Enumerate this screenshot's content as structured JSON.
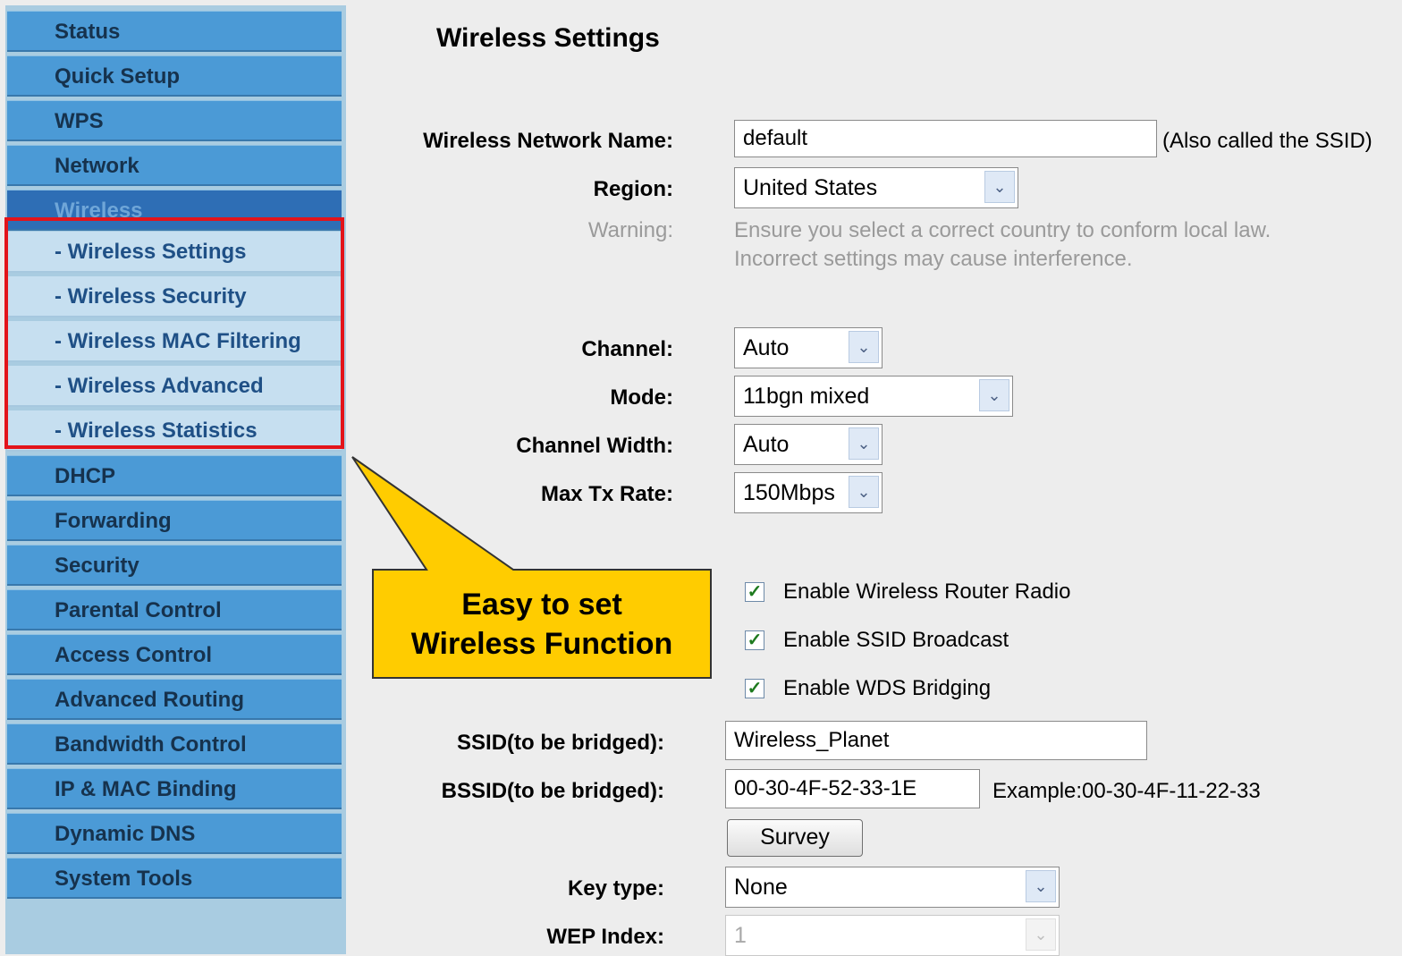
{
  "sidebar": {
    "items": [
      {
        "label": "Status"
      },
      {
        "label": "Quick Setup"
      },
      {
        "label": "WPS"
      },
      {
        "label": "Network"
      },
      {
        "label": "Wireless"
      },
      {
        "label": "DHCP"
      },
      {
        "label": "Forwarding"
      },
      {
        "label": "Security"
      },
      {
        "label": "Parental Control"
      },
      {
        "label": "Access Control"
      },
      {
        "label": "Advanced Routing"
      },
      {
        "label": "Bandwidth Control"
      },
      {
        "label": "IP & MAC Binding"
      },
      {
        "label": "Dynamic DNS"
      },
      {
        "label": "System Tools"
      }
    ],
    "active": "Wireless",
    "subitems": [
      {
        "label": "- Wireless Settings"
      },
      {
        "label": "- Wireless Security"
      },
      {
        "label": "- Wireless MAC Filtering"
      },
      {
        "label": "- Wireless Advanced"
      },
      {
        "label": "- Wireless Statistics"
      }
    ]
  },
  "callout": {
    "line1": "Easy to set",
    "line2": "Wireless Function"
  },
  "main": {
    "title": "Wireless Settings",
    "ssid": {
      "label": "Wireless Network Name:",
      "value": "default",
      "note": "(Also called the SSID)"
    },
    "region": {
      "label": "Region:",
      "value": "United States"
    },
    "warning": {
      "label": "Warning:",
      "line1": "Ensure you select a correct country to conform local law.",
      "line2": "Incorrect settings may cause interference."
    },
    "channel": {
      "label": "Channel:",
      "value": "Auto"
    },
    "mode": {
      "label": "Mode:",
      "value": "11bgn mixed"
    },
    "channel_width": {
      "label": "Channel Width:",
      "value": "Auto"
    },
    "max_tx_rate": {
      "label": "Max Tx Rate:",
      "value": "150Mbps"
    },
    "checkboxes": [
      {
        "label": "Enable Wireless Router Radio",
        "checked": true
      },
      {
        "label": "Enable SSID Broadcast",
        "checked": true
      },
      {
        "label": "Enable WDS Bridging",
        "checked": true
      }
    ],
    "ssid_bridged": {
      "label": "SSID(to be bridged):",
      "value": "Wireless_Planet"
    },
    "bssid_bridged": {
      "label": "BSSID(to be bridged):",
      "value": "00-30-4F-52-33-1E",
      "example": "Example:00-30-4F-11-22-33"
    },
    "survey_label": "Survey",
    "key_type": {
      "label": "Key type:",
      "value": "None"
    },
    "wep_index": {
      "label": "WEP Index:",
      "value": "1"
    }
  },
  "colors": {
    "nav_bg": "#4b9ad6",
    "nav_active": "#2e6eb5",
    "subnav_bg": "#c6dff0",
    "highlight": "#e3141a",
    "callout_fill": "#ffcc00"
  },
  "icons": {
    "dropdown": "chevron-down-icon",
    "checkbox": "check-icon"
  }
}
